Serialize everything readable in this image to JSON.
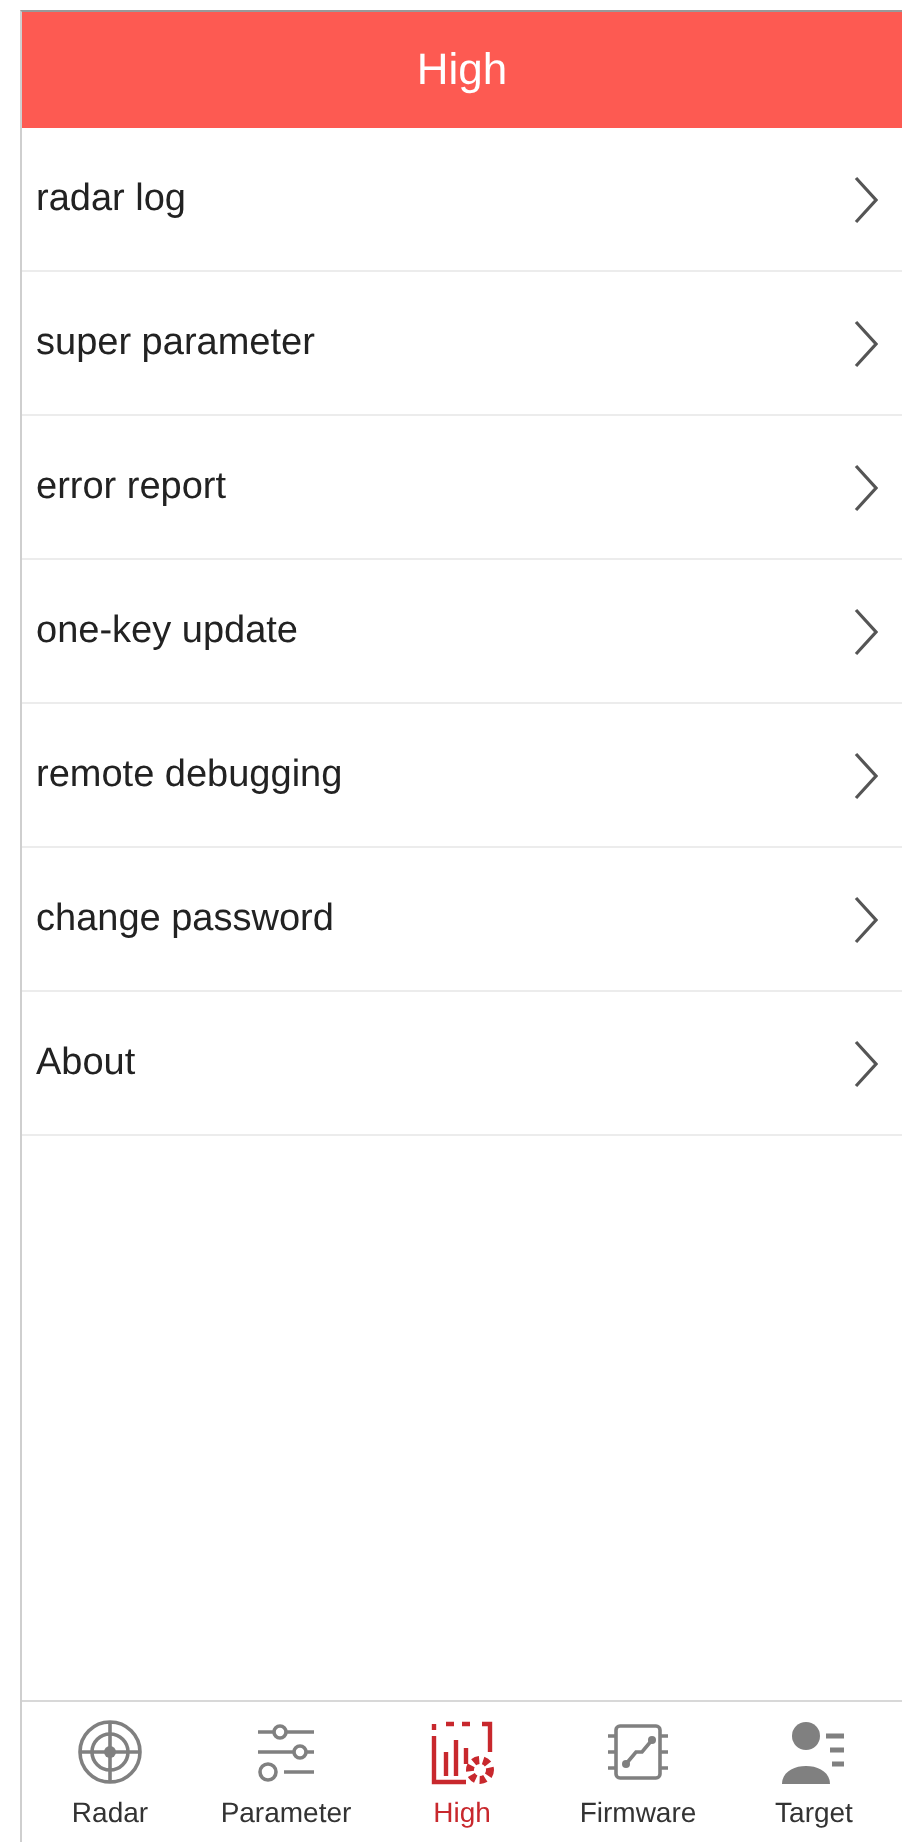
{
  "header": {
    "title": "High"
  },
  "menu": [
    {
      "label": "radar log"
    },
    {
      "label": "super parameter"
    },
    {
      "label": "error report"
    },
    {
      "label": "one-key update"
    },
    {
      "label": "remote debugging"
    },
    {
      "label": "change password"
    },
    {
      "label": "About"
    }
  ],
  "tabs": [
    {
      "label": "Radar",
      "kind": "radar",
      "selected": false
    },
    {
      "label": "Parameter",
      "kind": "sliders",
      "selected": false
    },
    {
      "label": "High",
      "kind": "chart",
      "selected": true
    },
    {
      "label": "Firmware",
      "kind": "chip",
      "selected": false
    },
    {
      "label": "Target",
      "kind": "person",
      "selected": false
    }
  ]
}
